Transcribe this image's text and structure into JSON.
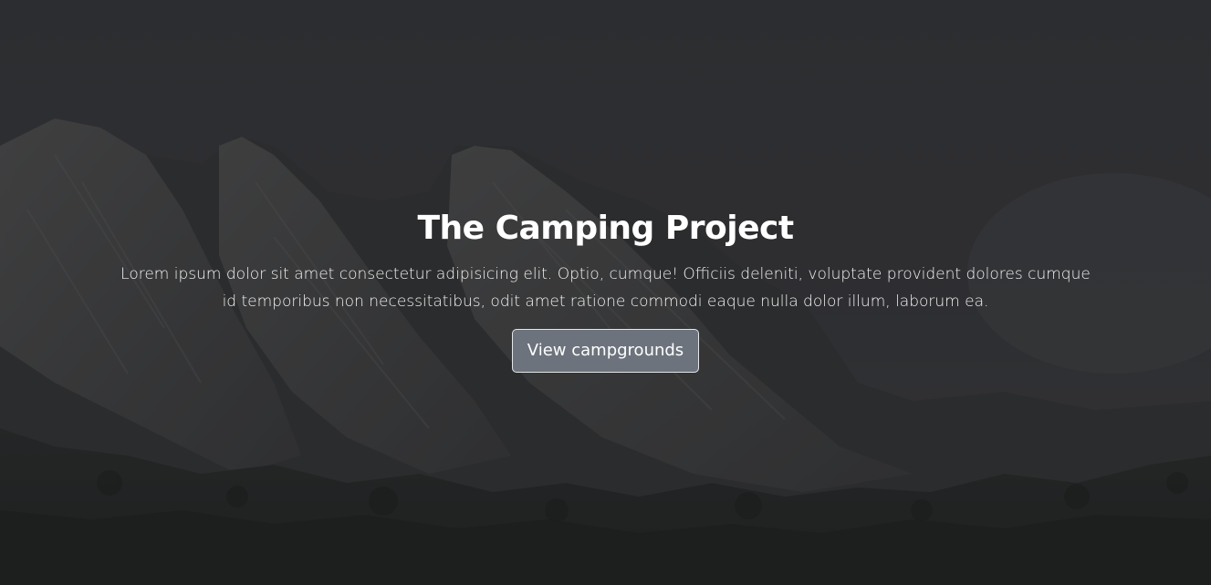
{
  "hero": {
    "title": "The Camping Project",
    "lead": "Lorem ipsum dolor sit amet consectetur adipisicing elit. Optio, cumque! Officiis deleniti, voluptate provident dolores cumque id temporibus non necessitatibus, odit amet ratione commodi eaque nulla dolor illum, laborum ea.",
    "cta_label": "View campgrounds"
  },
  "colors": {
    "background": "#2f3033",
    "button_bg": "#6c737d",
    "button_border": "#e4e6e9",
    "text": "#ffffff"
  }
}
